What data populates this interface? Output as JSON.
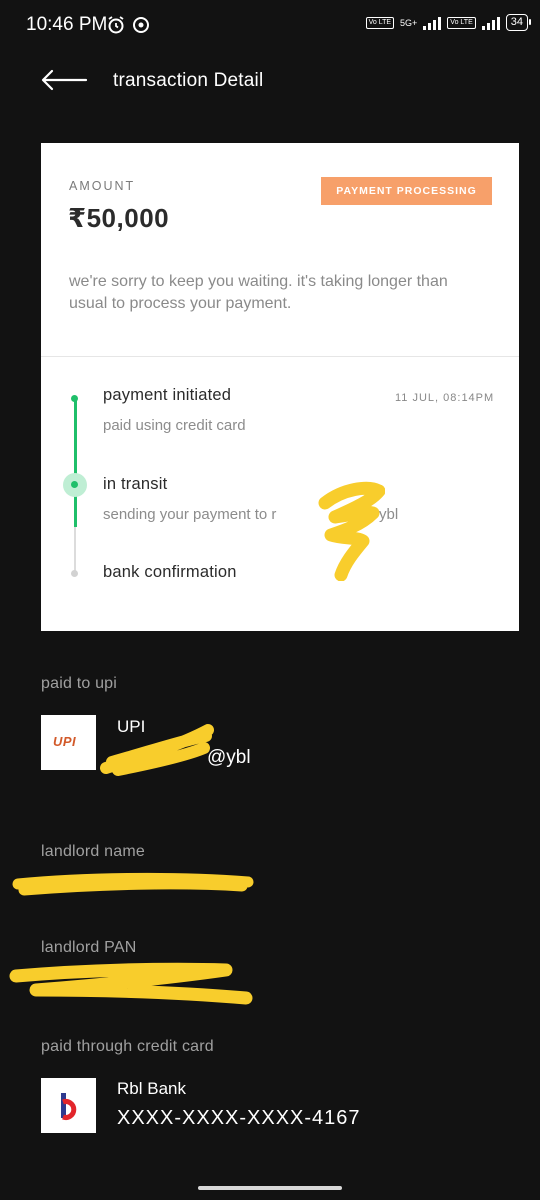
{
  "status_bar": {
    "time": "10:46 PM",
    "network_1": "Vo LTE",
    "network_2": "5G+",
    "network_3": "Vo LTE",
    "battery": "34"
  },
  "header": {
    "title": "transaction Detail",
    "back_icon": "arrow-left-icon"
  },
  "card": {
    "amount_label": "AMOUNT",
    "amount_value": "₹50,000",
    "status_badge": "PAYMENT PROCESSING",
    "message": "we're sorry to keep you waiting. it's taking longer than usual to process your payment.",
    "steps": [
      {
        "title": "payment initiated",
        "subtitle": "paid using credit card",
        "time": "11 JUL, 08:14PM",
        "state": "done"
      },
      {
        "title": "in transit",
        "subtitle": "sending your payment to r",
        "subtitle_suffix": "ybl",
        "state": "current"
      },
      {
        "title": "bank confirmation",
        "subtitle": "",
        "state": "pending"
      }
    ],
    "accent_color": "#1fbf6a",
    "badge_color": "#f7a06a"
  },
  "paid_to": {
    "label": "paid to upi",
    "logo_text": "UPI",
    "name": "UPI",
    "id_suffix": "@ybl"
  },
  "landlord_name": {
    "label": "landlord name"
  },
  "landlord_pan": {
    "label": "landlord PAN"
  },
  "credit_card": {
    "label": "paid through credit card",
    "bank": "Rbl Bank",
    "number": "XXXX-XXXX-XXXX-4167",
    "logo_text": "b"
  }
}
